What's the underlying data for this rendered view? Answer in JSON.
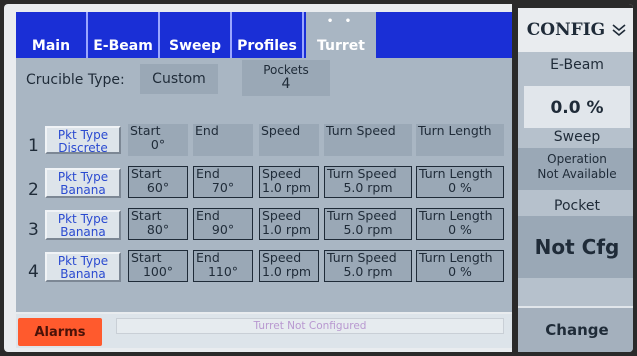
{
  "tabs": {
    "main": "Main",
    "ebeam": "E-Beam",
    "sweep": "Sweep",
    "profiles": "Profiles",
    "turret": "Turret",
    "turret_dots": "• •"
  },
  "crucible": {
    "label": "Crucible Type:",
    "value": "Custom",
    "pockets_label": "Pockets",
    "pockets_value": "4"
  },
  "rows": [
    {
      "num": "1",
      "pkt_label": "Pkt Type",
      "pkt_value": "Discrete",
      "start_label": "Start",
      "start_value": "0°",
      "end_label": "End",
      "end_value": "",
      "speed_label": "Speed",
      "speed_value": "",
      "turn_speed_label": "Turn Speed",
      "turn_speed_value": "",
      "turn_length_label": "Turn Length",
      "turn_length_value": ""
    },
    {
      "num": "2",
      "pkt_label": "Pkt Type",
      "pkt_value": "Banana",
      "start_label": "Start",
      "start_value": "60°",
      "end_label": "End",
      "end_value": "70°",
      "speed_label": "Speed",
      "speed_value": "1.0 rpm",
      "turn_speed_label": "Turn Speed",
      "turn_speed_value": "5.0 rpm",
      "turn_length_label": "Turn Length",
      "turn_length_value": "0 %"
    },
    {
      "num": "3",
      "pkt_label": "Pkt Type",
      "pkt_value": "Banana",
      "start_label": "Start",
      "start_value": "80°",
      "end_label": "End",
      "end_value": "90°",
      "speed_label": "Speed",
      "speed_value": "1.0 rpm",
      "turn_speed_label": "Turn Speed",
      "turn_speed_value": "5.0 rpm",
      "turn_length_label": "Turn Length",
      "turn_length_value": "0 %"
    },
    {
      "num": "4",
      "pkt_label": "Pkt Type",
      "pkt_value": "Banana",
      "start_label": "Start",
      "start_value": "100°",
      "end_label": "End",
      "end_value": "110°",
      "speed_label": "Speed",
      "speed_value": "1.0 rpm",
      "turn_speed_label": "Turn Speed",
      "turn_speed_value": "5.0 rpm",
      "turn_length_label": "Turn Length",
      "turn_length_value": "0 %"
    }
  ],
  "status": {
    "alarms": "Alarms",
    "message": "Turret Not Configured"
  },
  "sidebar": {
    "config": "CONFIG",
    "config_icon": "chevron-double-down-icon",
    "ebeam_label": "E-Beam",
    "ebeam_value": "0.0 %",
    "sweep_label": "Sweep",
    "sweep_line1": "Operation",
    "sweep_line2": "Not Available",
    "pocket_label": "Pocket",
    "pocket_value": "Not Cfg",
    "change": "Change"
  },
  "colors": {
    "tab_bar": "#1a2fd6",
    "panel": "#a9b6c3",
    "alarm": "#ff5a2d",
    "button_text": "#2a4ad0"
  }
}
